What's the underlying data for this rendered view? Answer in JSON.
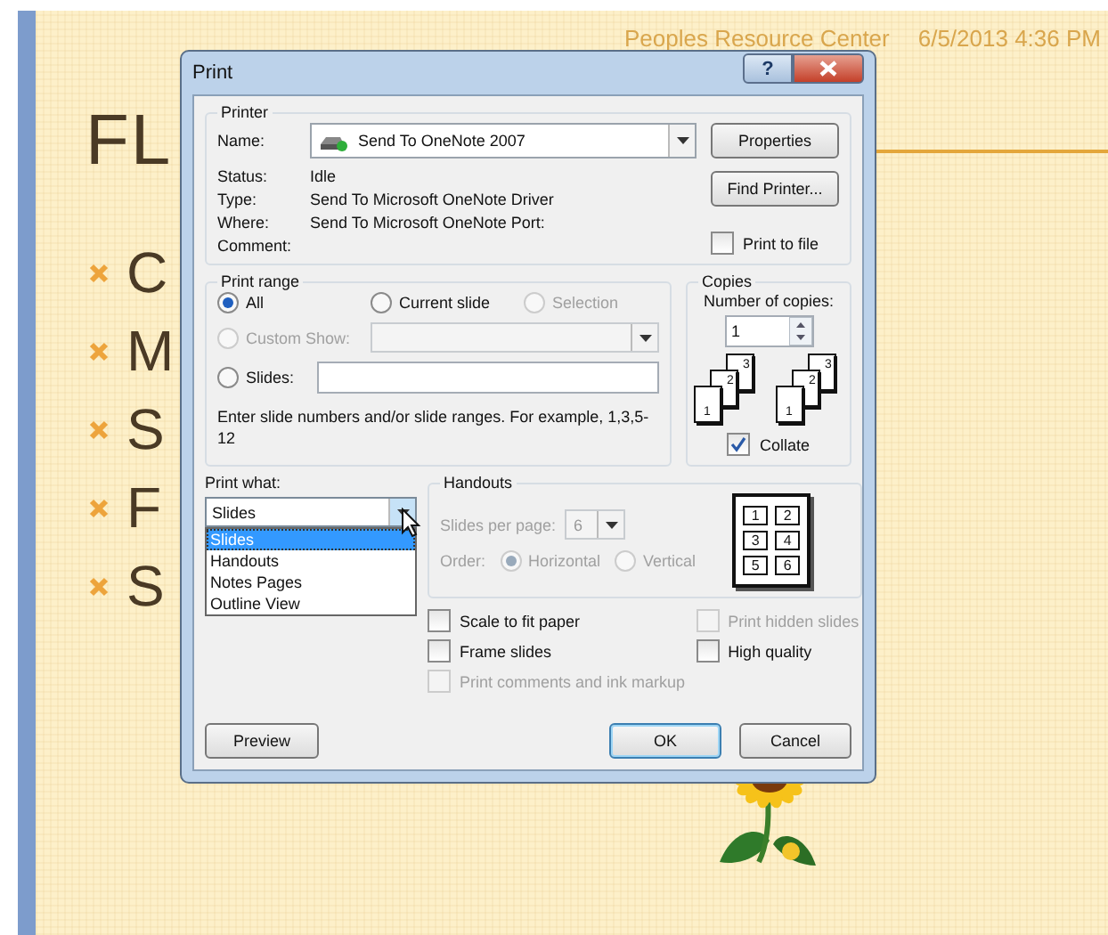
{
  "slide": {
    "header": "Peoples Resource Center",
    "date": "6/5/2013 4:36 PM",
    "title": "FL",
    "bullets": [
      "C",
      "M",
      "S",
      "F",
      "S"
    ]
  },
  "dialog": {
    "title": "Print",
    "help": "?"
  },
  "printer": {
    "group": "Printer",
    "name_label": "Name:",
    "name_value": "Send To OneNote 2007",
    "buttons": [
      "Properties",
      "Find Printer..."
    ],
    "info": [
      {
        "label": "Status:",
        "value": "Idle"
      },
      {
        "label": "Type:",
        "value": "Send To Microsoft OneNote Driver"
      },
      {
        "label": "Where:",
        "value": "Send To Microsoft OneNote Port:"
      },
      {
        "label": "Comment:"
      }
    ],
    "print_to_file": {
      "label": "Print to file",
      "checked": false
    }
  },
  "print_range": {
    "group": "Print range",
    "options": [
      {
        "label": "All",
        "selected": true,
        "disabled": false
      },
      {
        "label": "Current slide",
        "selected": false,
        "disabled": false
      },
      {
        "label": "Selection",
        "selected": false,
        "disabled": true
      }
    ],
    "custom_show": {
      "label": "Custom Show:",
      "selected": false,
      "disabled": true
    },
    "slides": {
      "label": "Slides:",
      "selected": false,
      "disabled": false
    },
    "hint": "Enter slide numbers and/or slide ranges. For example, 1,3,5-12"
  },
  "copies": {
    "group": "Copies",
    "count_label": "Number of copies:",
    "count": "1",
    "stacks": [
      [
        "1",
        "2",
        "3"
      ],
      [
        "1",
        "2",
        "3"
      ]
    ],
    "collate": {
      "label": "Collate",
      "checked": true
    }
  },
  "print_what": {
    "label": "Print what:",
    "value": "Slides",
    "expanded": true,
    "options": [
      {
        "label": "Slides",
        "selected": true
      },
      {
        "label": "Handouts",
        "selected": false
      },
      {
        "label": "Notes Pages",
        "selected": false
      },
      {
        "label": "Outline View",
        "selected": false
      }
    ]
  },
  "handouts": {
    "group": "Handouts",
    "disabled": true,
    "per_page_label": "Slides per page:",
    "per_page": "6",
    "order_label": "Order:",
    "orders": [
      {
        "label": "Horizontal",
        "selected": true
      },
      {
        "label": "Vertical",
        "selected": false
      }
    ],
    "preview": [
      "1",
      "2",
      "3",
      "4",
      "5",
      "6"
    ]
  },
  "options": [
    {
      "label": "Scale to fit paper",
      "checked": false,
      "disabled": false
    },
    {
      "label": "Print hidden slides",
      "checked": false,
      "disabled": true
    },
    {
      "label": "Frame slides",
      "checked": false,
      "disabled": false
    },
    {
      "label": "High quality",
      "checked": false,
      "disabled": false
    },
    {
      "label": "Print comments and ink markup",
      "checked": false,
      "disabled": true
    }
  ],
  "buttons": [
    {
      "label": "Preview",
      "default": false
    },
    {
      "label": "OK",
      "default": true
    },
    {
      "label": "Cancel",
      "default": false
    }
  ]
}
